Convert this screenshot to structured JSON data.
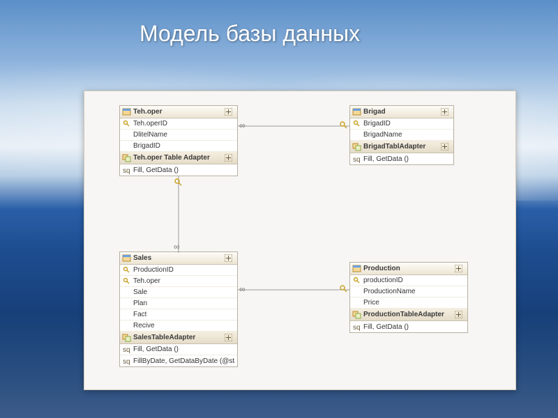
{
  "title": "Модель базы данных",
  "entities": {
    "tehoper": {
      "name": "Teh.oper",
      "adapter": "Teh.oper Table Adapter",
      "columns": [
        {
          "name": "Teh.operID",
          "pk": true
        },
        {
          "name": "DlitelName",
          "pk": false
        },
        {
          "name": "BrigadID",
          "pk": false
        }
      ],
      "methods": [
        "Fill, GetData ()"
      ]
    },
    "brigad": {
      "name": "Brigad",
      "adapter": "BrigadTablAdapter",
      "columns": [
        {
          "name": "BrigadID",
          "pk": true
        },
        {
          "name": "BrigadName",
          "pk": false
        }
      ],
      "methods": [
        "Fill, GetData ()"
      ]
    },
    "sales": {
      "name": "Sales",
      "adapter": "SalesTableAdapter",
      "columns": [
        {
          "name": "ProductionID",
          "pk": true
        },
        {
          "name": "Teh.oper",
          "pk": true
        },
        {
          "name": "Sale",
          "pk": false
        },
        {
          "name": "Plan",
          "pk": false
        },
        {
          "name": "Fact",
          "pk": false
        },
        {
          "name": "Recive",
          "pk": false
        }
      ],
      "methods": [
        "Fill, GetData ()",
        "FillByDate, GetDataByDate (@startDate, ..."
      ]
    },
    "production": {
      "name": "Production",
      "adapter": "ProductionTableAdapter",
      "columns": [
        {
          "name": "productionID",
          "pk": true
        },
        {
          "name": "ProductionName",
          "pk": false
        },
        {
          "name": "Price",
          "pk": false
        }
      ],
      "methods": [
        "Fill, GetData ()"
      ]
    }
  },
  "relations": [
    {
      "from": "tehoper",
      "to": "brigad"
    },
    {
      "from": "tehoper",
      "to": "sales"
    },
    {
      "from": "sales",
      "to": "production"
    }
  ]
}
